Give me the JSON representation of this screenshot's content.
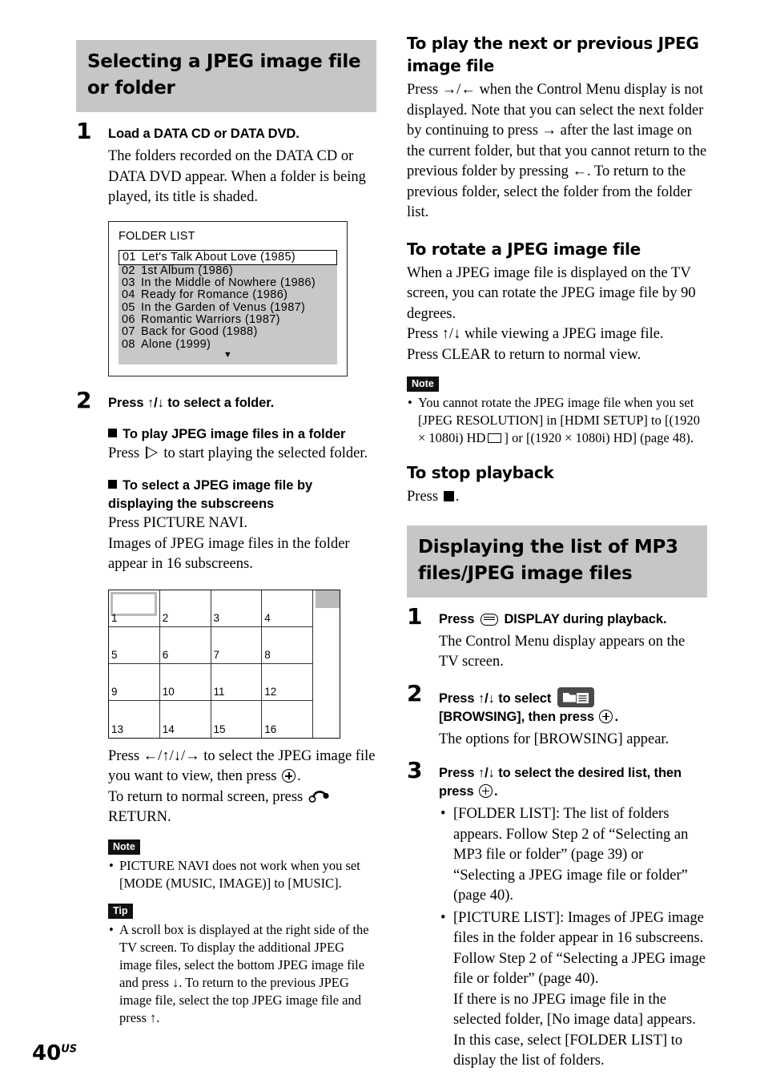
{
  "page": {
    "number": "40",
    "region": "US"
  },
  "left": {
    "banner": "Selecting a JPEG image file or folder",
    "step1": {
      "num": "1",
      "title": "Load a DATA CD or DATA DVD.",
      "body": "The folders recorded on the DATA CD or DATA DVD appear. When a folder is being played, its title is shaded."
    },
    "folder_screen": {
      "title": "FOLDER LIST",
      "rows": [
        {
          "index": "01",
          "name": "Let's Talk About Love (1985)"
        },
        {
          "index": "02",
          "name": "1st Album (1986)"
        },
        {
          "index": "03",
          "name": "In the Middle of Nowhere (1986)"
        },
        {
          "index": "04",
          "name": "Ready for Romance (1986)"
        },
        {
          "index": "05",
          "name": "In the Garden of Venus (1987)"
        },
        {
          "index": "06",
          "name": "Romantic Warriors (1987)"
        },
        {
          "index": "07",
          "name": "Back for Good (1988)"
        },
        {
          "index": "08",
          "name": "Alone (1999)"
        }
      ],
      "more_caret": "▼"
    },
    "step2": {
      "num": "2",
      "title": "Press ↑/↓ to select a folder.",
      "sub1_head": "To play JPEG image files in a folder",
      "sub1_body_before": "Press",
      "sub1_body_after": "to start playing the selected folder.",
      "sub2_head": "To select a JPEG image file by displaying the subscreens",
      "sub2_body_1": "Press PICTURE NAVI.",
      "sub2_body_2": "Images of JPEG image files in the folder appear in 16 subscreens."
    },
    "subscreen_grid": {
      "cells": [
        "1",
        "2",
        "3",
        "4",
        "5",
        "6",
        "7",
        "8",
        "9",
        "10",
        "11",
        "12",
        "13",
        "14",
        "15",
        "16"
      ]
    },
    "grid_caption_1a": "Press ←/↑/↓/→ to select the JPEG image file you want to view, then press",
    "grid_caption_1b": ".",
    "grid_caption_2a": "To return to normal screen, press",
    "grid_caption_2b": "RETURN.",
    "note": {
      "badge": "Note",
      "items": [
        "PICTURE NAVI does not work when you set [MODE (MUSIC, IMAGE)] to [MUSIC]."
      ]
    },
    "tip": {
      "badge": "Tip",
      "items": [
        "A scroll box is displayed at the right side of the TV screen. To display the additional JPEG image files, select the bottom JPEG image file and press ↓. To return to the previous JPEG image file, select the top JPEG image file and press ↑."
      ]
    }
  },
  "right": {
    "sec1": {
      "head": "To play the next or previous JPEG image file",
      "body": "Press →/← when the Control Menu display is not displayed. Note that you can select the next folder by continuing to press → after the last image on the current folder, but that you cannot return to the previous folder by pressing ←. To return to the previous folder, select the folder from the folder list."
    },
    "sec2": {
      "head": "To rotate a JPEG image file",
      "body_1": "When a JPEG image file is displayed on the TV screen, you can rotate the JPEG image file by 90 degrees.",
      "body_2": "Press ↑/↓ while viewing a JPEG image file.",
      "body_3": "Press CLEAR to return to normal view."
    },
    "note": {
      "badge": "Note",
      "text_a": "You cannot rotate the JPEG image file when you set [JPEG RESOLUTION] in [HDMI SETUP] to [(1920 × 1080i) HD",
      "text_b": "] or [(1920 × 1080i) HD] (page 48)."
    },
    "sec3": {
      "head": "To stop playback",
      "body_before": "Press",
      "body_after": "."
    },
    "banner": "Displaying the list of MP3 files/JPEG image files",
    "step1": {
      "num": "1",
      "title_before": "Press",
      "title_after": "DISPLAY during playback.",
      "body": "The Control Menu display appears on the TV screen."
    },
    "step2": {
      "num": "2",
      "title_before": "Press ↑/↓ to select",
      "title_mid": "[BROWSING], then press",
      "title_after": ".",
      "body": "The options for [BROWSING] appear."
    },
    "step3": {
      "num": "3",
      "title_before": "Press ↑/↓ to select the desired list, then press",
      "title_after": ".",
      "bullets": [
        "[FOLDER LIST]: The list of folders appears. Follow Step 2 of “Selecting an MP3 file or folder” (page 39) or “Selecting a JPEG image file or folder” (page 40).",
        "[PICTURE LIST]: Images of JPEG image files in the folder appear in 16 subscreens. Follow Step 2 of “Selecting a JPEG image file or folder” (page 40).\nIf there is no JPEG image file in the selected folder, [No image data] appears. In this case, select [FOLDER LIST] to display the list of folders."
      ]
    }
  }
}
